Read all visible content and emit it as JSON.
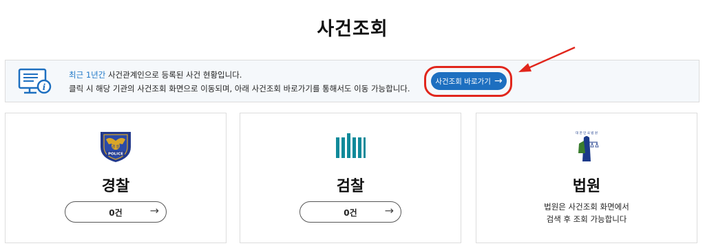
{
  "header": {
    "title": "사건조회"
  },
  "info": {
    "highlight": "최근 1년간",
    "line1_rest": " 사건관계인으로 등록된 사건 현황입니다.",
    "line2": "클릭 시 해당 기관의 사건조회 화면으로 이동되며, 아래 사건조회 바로가기를 통해서도 이동 가능합니다.",
    "icon": "monitor-info-icon",
    "shortcut_label": "사건조회 바로가기",
    "shortcut_arrow": "→"
  },
  "cards": [
    {
      "title": "경찰",
      "emblem": "police-emblem",
      "emblem_text": "POLICE",
      "emblem_text2": "경 찰",
      "count_label": "0건",
      "arrow": "→"
    },
    {
      "title": "검찰",
      "emblem": "prosecution-emblem",
      "count_label": "0건",
      "arrow": "→"
    },
    {
      "title": "법원",
      "emblem": "court-emblem",
      "emblem_text": "대 한 민 국 법 원",
      "desc_line1": "법원은 사건조회 화면에서",
      "desc_line2": "검색 후 조회 가능합니다"
    }
  ],
  "colors": {
    "accent": "#1d6fc0",
    "highlight": "#1f78c8",
    "annotation": "#e1261c"
  }
}
